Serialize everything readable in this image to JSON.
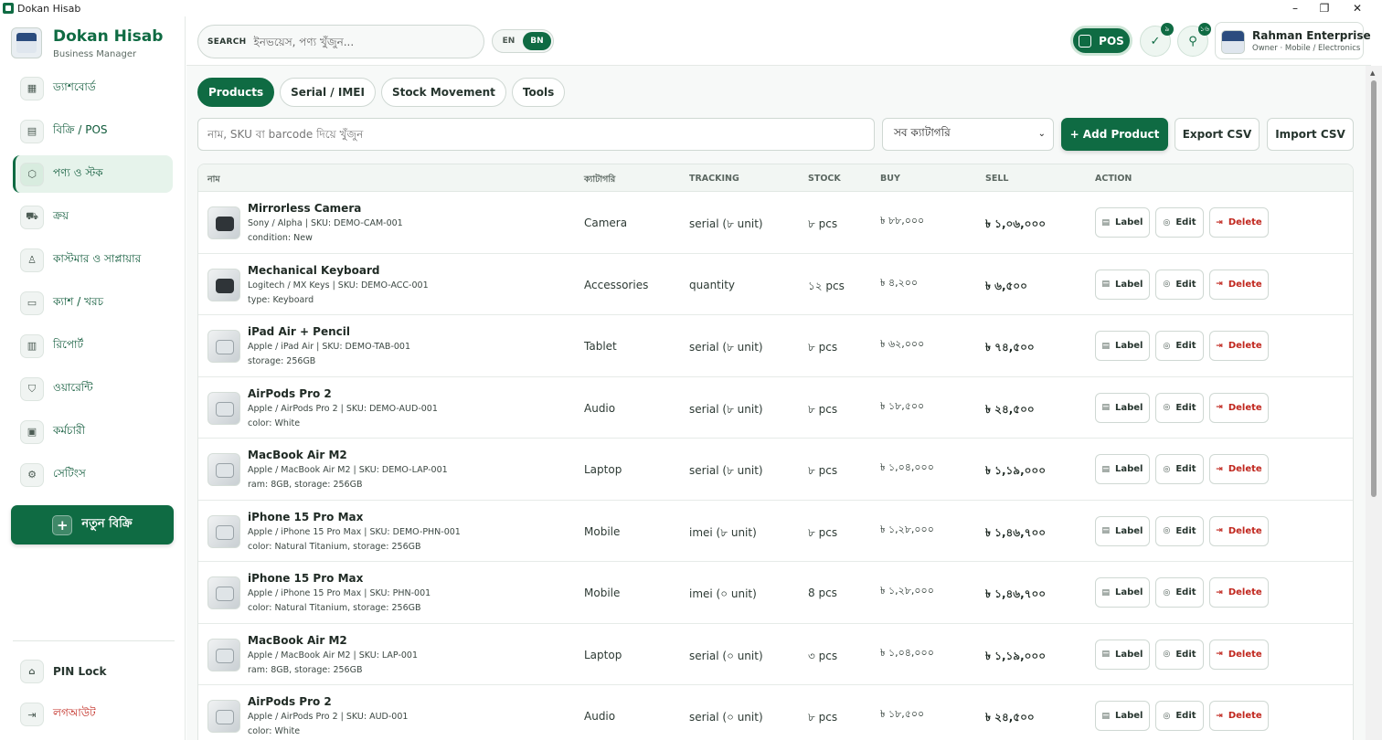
{
  "window": {
    "title": "Dokan Hisab",
    "minimize": "–",
    "maximize": "❐",
    "close": "✕"
  },
  "brand": {
    "name": "Dokan Hisab",
    "subtitle": "Business Manager"
  },
  "sidebar": {
    "items": [
      {
        "label": "ড্যাশবোর্ড",
        "icon": "grid-icon",
        "glyph": "▦",
        "active": false
      },
      {
        "label": "বিক্রি / POS",
        "icon": "receipt-icon",
        "glyph": "▤",
        "active": false
      },
      {
        "label": "পণ্য ও স্টক",
        "icon": "box-icon",
        "glyph": "⬡",
        "active": true
      },
      {
        "label": "ক্রয়",
        "icon": "truck-icon",
        "glyph": "⛟",
        "active": false
      },
      {
        "label": "কাস্টমার ও সাপ্লায়ার",
        "icon": "users-icon",
        "glyph": "♙",
        "active": false
      },
      {
        "label": "ক্যাশ / খরচ",
        "icon": "wallet-icon",
        "glyph": "▭",
        "active": false
      },
      {
        "label": "রিপোর্ট",
        "icon": "chart-icon",
        "glyph": "▥",
        "active": false
      },
      {
        "label": "ওয়ারেন্টি",
        "icon": "shield-icon",
        "glyph": "⛉",
        "active": false
      },
      {
        "label": "কর্মচারী",
        "icon": "calendar-icon",
        "glyph": "▣",
        "active": false
      },
      {
        "label": "সেটিংস",
        "icon": "gear-icon",
        "glyph": "⚙",
        "active": false
      }
    ],
    "new_sale": {
      "label": "নতুন বিক্রি",
      "icon_glyph": "+"
    },
    "pin_lock": {
      "label": "PIN Lock",
      "glyph": "🔒"
    },
    "logout": {
      "label": "লগআউট",
      "glyph": "⇥"
    }
  },
  "header": {
    "search_label": "SEARCH",
    "search_placeholder": "ইনভয়েস, পণ্য খুঁজুন...",
    "lang_en": "EN",
    "lang_bn": "BN",
    "pos_label": "POS",
    "warranty_badge": "৯",
    "tools_badge": "১৬",
    "profile": {
      "name": "Rahman Enterprise",
      "role": "Owner · Mobile / Electronics"
    }
  },
  "tabs": [
    {
      "label": "Products",
      "active": true
    },
    {
      "label": "Serial / IMEI",
      "active": false
    },
    {
      "label": "Stock Movement",
      "active": false
    },
    {
      "label": "Tools",
      "active": false
    }
  ],
  "toolbar": {
    "filter_placeholder": "নাম, SKU বা barcode দিয়ে খুঁজুন",
    "category_selected": "সব ক্যাটাগরি",
    "add_product": "+ Add Product",
    "export_csv": "Export CSV",
    "import_csv": "Import CSV"
  },
  "table": {
    "columns": [
      "নাম",
      "ক্যাটাগরি",
      "TRACKING",
      "STOCK",
      "BUY",
      "SELL",
      "ACTION"
    ],
    "actions": {
      "label": "Label",
      "edit": "Edit",
      "delete": "Delete"
    },
    "rows": [
      {
        "name": "Mirrorless Camera",
        "meta": "Sony / Alpha | SKU: DEMO-CAM-001",
        "attr": "condition: New",
        "category": "Camera",
        "tracking": "serial (৮ unit)",
        "stock": "৮ pcs",
        "buy": "৳ ৮৮,০০০",
        "sell": "৳ ১,০৬,০০০",
        "thumb": "dark"
      },
      {
        "name": "Mechanical Keyboard",
        "meta": "Logitech / MX Keys | SKU: DEMO-ACC-001",
        "attr": "type: Keyboard",
        "category": "Accessories",
        "tracking": "quantity",
        "stock": "১২ pcs",
        "buy": "৳ ৪,২০০",
        "sell": "৳ ৬,৫০০",
        "thumb": "dark"
      },
      {
        "name": "iPad Air + Pencil",
        "meta": "Apple / iPad Air | SKU: DEMO-TAB-001",
        "attr": "storage: 256GB",
        "category": "Tablet",
        "tracking": "serial (৮ unit)",
        "stock": "৮ pcs",
        "buy": "৳ ৬২,০০০",
        "sell": "৳ ৭৪,৫০০",
        "thumb": "light"
      },
      {
        "name": "AirPods Pro 2",
        "meta": "Apple / AirPods Pro 2 | SKU: DEMO-AUD-001",
        "attr": "color: White",
        "category": "Audio",
        "tracking": "serial (৮ unit)",
        "stock": "৮ pcs",
        "buy": "৳ ১৮,৫০০",
        "sell": "৳ ২৪,৫০০",
        "thumb": "light"
      },
      {
        "name": "MacBook Air M2",
        "meta": "Apple / MacBook Air M2 | SKU: DEMO-LAP-001",
        "attr": "ram: 8GB, storage: 256GB",
        "category": "Laptop",
        "tracking": "serial (৮ unit)",
        "stock": "৮ pcs",
        "buy": "৳ ১,০৪,০০০",
        "sell": "৳ ১,১৯,০০০",
        "thumb": "light"
      },
      {
        "name": "iPhone 15 Pro Max",
        "meta": "Apple / iPhone 15 Pro Max | SKU: DEMO-PHN-001",
        "attr": "color: Natural Titanium, storage: 256GB",
        "category": "Mobile",
        "tracking": "imei (৮ unit)",
        "stock": "৮ pcs",
        "buy": "৳ ১,২৮,০০০",
        "sell": "৳ ১,৪৬,৭০০",
        "thumb": "light"
      },
      {
        "name": "iPhone 15 Pro Max",
        "meta": "Apple / iPhone 15 Pro Max | SKU: PHN-001",
        "attr": "color: Natural Titanium, storage: 256GB",
        "category": "Mobile",
        "tracking": "imei (০ unit)",
        "stock": "8 pcs",
        "buy": "৳ ১,২৮,০০০",
        "sell": "৳ ১,৪৬,৭০০",
        "thumb": "light"
      },
      {
        "name": "MacBook Air M2",
        "meta": "Apple / MacBook Air M2 | SKU: LAP-001",
        "attr": "ram: 8GB, storage: 256GB",
        "category": "Laptop",
        "tracking": "serial (০ unit)",
        "stock": "৩ pcs",
        "buy": "৳ ১,০৪,০০০",
        "sell": "৳ ১,১৯,০০০",
        "thumb": "light"
      },
      {
        "name": "AirPods Pro 2",
        "meta": "Apple / AirPods Pro 2 | SKU: AUD-001",
        "attr": "color: White",
        "category": "Audio",
        "tracking": "serial (০ unit)",
        "stock": "৮ pcs",
        "buy": "৳ ১৮,৫০০",
        "sell": "৳ ২৪,৫০০",
        "thumb": "light"
      }
    ]
  },
  "colors": {
    "brand_green": "#0f6b43",
    "danger": "#c0261d",
    "active_bg": "#e6f3eb"
  }
}
